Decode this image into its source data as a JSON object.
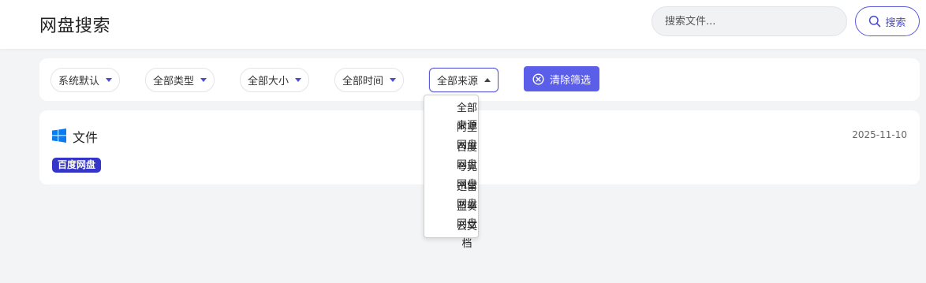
{
  "header": {
    "title": "网盘搜索",
    "search_placeholder": "搜索文件...",
    "search_button_label": "搜索"
  },
  "filters": [
    {
      "label": "系统默认"
    },
    {
      "label": "全部类型"
    },
    {
      "label": "全部大小"
    },
    {
      "label": "全部时间"
    },
    {
      "label": "全部来源"
    }
  ],
  "clear_button_label": "清除筛选",
  "source_dropdown": {
    "options": [
      "全部来源",
      "阿里网盘",
      "百度网盘",
      "夸克网盘",
      "迅雷网盘",
      "蓝奏网盘",
      "云文档"
    ]
  },
  "results": [
    {
      "name": "文件",
      "date": "2025-11-10",
      "source": "百度网盘",
      "icon": "windows-icon"
    }
  ],
  "colors": {
    "accent": "#5b5ee8",
    "badge": "#3535c9",
    "windows_blue": "#0a7cf0"
  }
}
